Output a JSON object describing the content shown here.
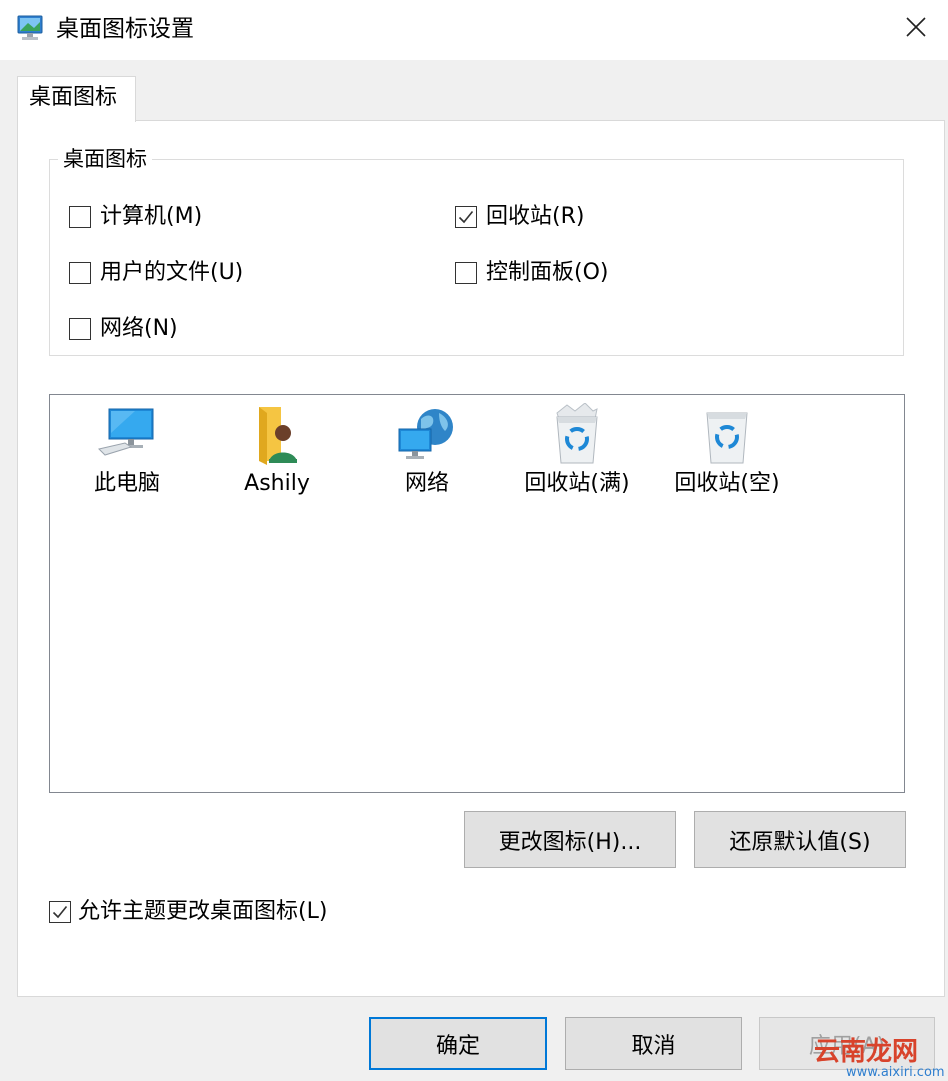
{
  "window": {
    "title": "桌面图标设置",
    "close_glyph": "✕"
  },
  "tab": {
    "label": "桌面图标"
  },
  "group": {
    "legend": "桌面图标",
    "checkboxes": [
      {
        "label": "计算机(M)",
        "checked": false
      },
      {
        "label": "回收站(R)",
        "checked": true
      },
      {
        "label": "用户的文件(U)",
        "checked": false
      },
      {
        "label": "控制面板(O)",
        "checked": false
      },
      {
        "label": "网络(N)",
        "checked": false
      }
    ]
  },
  "icons": [
    {
      "label": "此电脑",
      "icon": "computer-icon"
    },
    {
      "label": "Ashily",
      "icon": "user-folder-icon"
    },
    {
      "label": "网络",
      "icon": "network-icon"
    },
    {
      "label": "回收站(满)",
      "icon": "recycle-bin-full-icon"
    },
    {
      "label": "回收站(空)",
      "icon": "recycle-bin-empty-icon"
    }
  ],
  "buttons": {
    "change_icon": "更改图标(H)...",
    "restore_default": "还原默认值(S)",
    "ok": "确定",
    "cancel": "取消",
    "apply": "应用(A)"
  },
  "allow_themes": {
    "label": "允许主题更改桌面图标(L)",
    "checked": true
  },
  "watermark": {
    "main": "云南龙网",
    "sub": "www.aixiri.com"
  },
  "colors": {
    "accent": "#0078d7",
    "checkmark": "#333333"
  }
}
